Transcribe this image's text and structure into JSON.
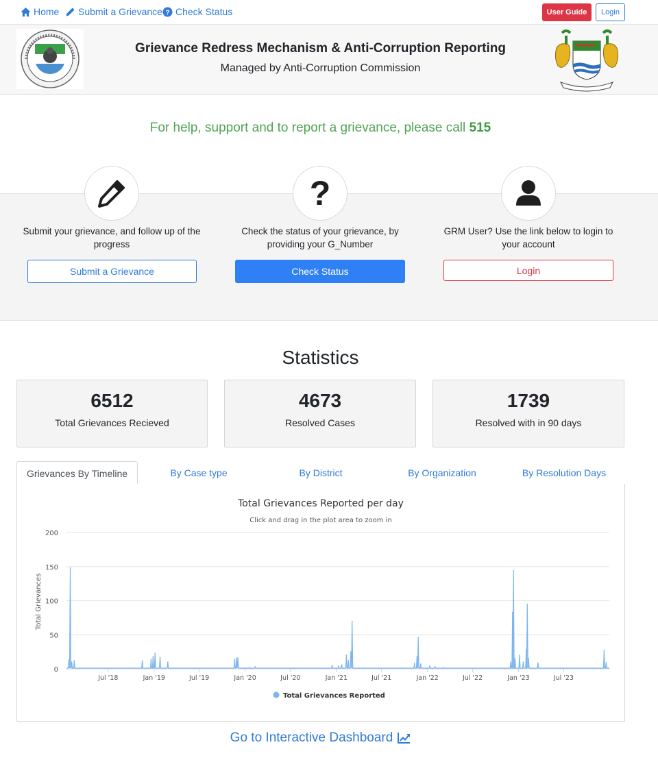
{
  "nav": {
    "home": "Home",
    "submit": "Submit a Grievance",
    "check": "Check Status",
    "user_guide": "User Guide",
    "login": "Login"
  },
  "header": {
    "title": "Grievance Redress Mechanism & Anti-Corruption Reporting",
    "subtitle": "Managed by Anti-Corruption Commission",
    "left_logo_icon": "anti-corruption-commission-seal",
    "right_logo_icon": "sierra-leone-coat-of-arms"
  },
  "help": {
    "text": "For help, support and to report a grievance, please call ",
    "number": "515"
  },
  "cards": [
    {
      "icon": "pencil-icon",
      "text": "Submit your grievance, and follow up of the progress",
      "button": "Submit a Grievance"
    },
    {
      "icon": "question-icon",
      "symbol": "?",
      "text": "Check the status of your grievance, by providing your G_Number",
      "button": "Check Status"
    },
    {
      "icon": "user-icon",
      "text": "GRM User? Use the link below to login to your account",
      "button": "Login"
    }
  ],
  "statistics": {
    "title": "Statistics",
    "items": [
      {
        "value": "6512",
        "label": "Total Grievances Recieved"
      },
      {
        "value": "4673",
        "label": "Resolved Cases"
      },
      {
        "value": "1739",
        "label": "Resolved with in 90 days"
      }
    ]
  },
  "tabs": [
    "Grievances By Timeline",
    "By Case type",
    "By District",
    "By Organization",
    "By Resolution Days"
  ],
  "colors": {
    "accent": "#2f7bd6",
    "danger": "#dc3545",
    "help_green": "#4fa352",
    "series": "#7cb5ec"
  },
  "chart_data": {
    "type": "area",
    "title": "Total Grievances Reported per day",
    "subtitle": "Click and drag in the plot area to zoom in",
    "ylabel": "Total Grievances",
    "xlabel": "",
    "ylim": [
      0,
      200
    ],
    "yticks": [
      "0",
      "50",
      "100",
      "150",
      "200"
    ],
    "xticks": [
      {
        "label": "Jul '18",
        "date": "2018-07-01"
      },
      {
        "label": "Jan '19",
        "date": "2019-01-01"
      },
      {
        "label": "Jul '19",
        "date": "2019-07-01"
      },
      {
        "label": "Jan '20",
        "date": "2020-01-01"
      },
      {
        "label": "Jul '20",
        "date": "2020-07-01"
      },
      {
        "label": "Jan '21",
        "date": "2021-01-01"
      },
      {
        "label": "Jul '21",
        "date": "2021-07-01"
      },
      {
        "label": "Jan '22",
        "date": "2022-01-01"
      },
      {
        "label": "Jul '22",
        "date": "2022-07-01"
      },
      {
        "label": "Jan '23",
        "date": "2023-01-01"
      },
      {
        "label": "Jul '23",
        "date": "2023-07-01"
      }
    ],
    "x_range": [
      "2018-01-15",
      "2023-12-31"
    ],
    "grid": true,
    "legend_position": "bottom-center",
    "series": [
      {
        "name": "Total Grievances Reported",
        "points": [
          [
            "2018-01-25",
            13
          ],
          [
            "2018-01-30",
            148
          ],
          [
            "2018-02-05",
            10
          ],
          [
            "2018-02-15",
            12
          ],
          [
            "2018-11-15",
            12
          ],
          [
            "2018-12-20",
            14
          ],
          [
            "2018-12-28",
            18
          ],
          [
            "2019-01-05",
            23
          ],
          [
            "2019-01-25",
            17
          ],
          [
            "2019-02-25",
            10
          ],
          [
            "2019-11-20",
            14
          ],
          [
            "2019-11-28",
            16
          ],
          [
            "2019-12-03",
            16
          ],
          [
            "2020-01-20",
            2
          ],
          [
            "2020-02-10",
            3
          ],
          [
            "2020-12-15",
            5
          ],
          [
            "2021-01-10",
            4
          ],
          [
            "2021-01-22",
            6
          ],
          [
            "2021-02-10",
            20
          ],
          [
            "2021-02-18",
            12
          ],
          [
            "2021-02-28",
            25
          ],
          [
            "2021-03-05",
            70
          ],
          [
            "2021-11-10",
            8
          ],
          [
            "2021-11-20",
            18
          ],
          [
            "2021-11-25",
            46
          ],
          [
            "2021-12-05",
            7
          ],
          [
            "2022-01-10",
            4
          ],
          [
            "2022-02-01",
            3
          ],
          [
            "2022-03-05",
            2
          ],
          [
            "2022-12-01",
            10
          ],
          [
            "2022-12-08",
            83
          ],
          [
            "2022-12-12",
            144
          ],
          [
            "2022-12-18",
            15
          ],
          [
            "2023-01-05",
            20
          ],
          [
            "2023-01-20",
            10
          ],
          [
            "2023-02-01",
            28
          ],
          [
            "2023-02-05",
            95
          ],
          [
            "2023-02-10",
            15
          ],
          [
            "2023-03-20",
            9
          ],
          [
            "2023-12-10",
            27
          ],
          [
            "2023-12-18",
            9
          ]
        ]
      }
    ]
  },
  "dashboard_link": "Go to Interactive Dashboard"
}
